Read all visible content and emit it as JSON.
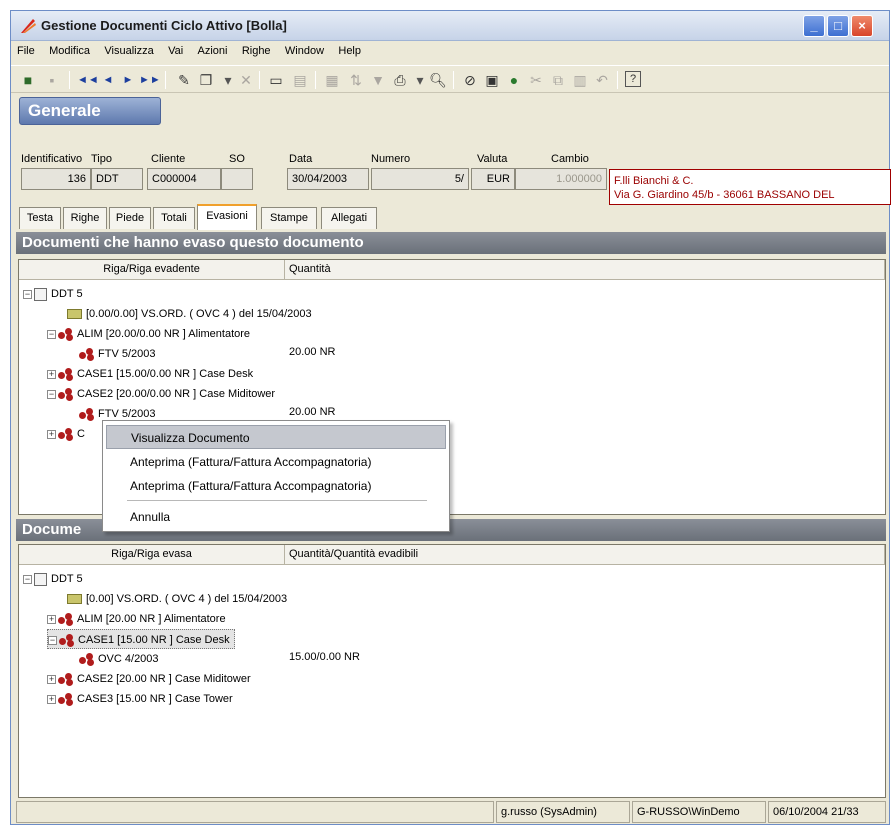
{
  "window": {
    "title": "Gestione Documenti Ciclo Attivo [Bolla]",
    "controls": {
      "minimize": "_",
      "maximize": "□",
      "close": "×"
    }
  },
  "menu": [
    "File",
    "Modifica",
    "Visualizza",
    "Vai",
    "Azioni",
    "Righe",
    "Window",
    "Help"
  ],
  "toolbar_icons": [
    "save-icon",
    "first-record-icon",
    "prev-record-icon",
    "next-record-icon",
    "last-record-icon",
    "edit-icon",
    "new-doc-icon",
    "delete-icon",
    "window-icon",
    "print-icon",
    "preview-icon",
    "help-icon"
  ],
  "general_button": "Generale",
  "header": {
    "labels": {
      "identificativo": "Identificativo",
      "tipo": "Tipo",
      "cliente": "Cliente",
      "so": "SO",
      "data": "Data",
      "numero": "Numero",
      "valuta": "Valuta",
      "cambio": "Cambio"
    },
    "values": {
      "identificativo": "136",
      "tipo": "DDT",
      "cliente": "C000004",
      "so": "",
      "data": "30/04/2003",
      "numero": "5/",
      "valuta": "EUR",
      "cambio": "1.000000"
    },
    "address_line1": "F.lli Bianchi & C.",
    "address_line2": "Via G. Giardino 45/b - 36061 BASSANO DEL"
  },
  "tabs": [
    "Testa",
    "Righe",
    "Piede",
    "Totali",
    "Evasioni",
    "Stampe",
    "Allegati"
  ],
  "section1": {
    "title": "Documenti che hanno evaso questo documento",
    "col1": "Riga/Riga evadente",
    "col2": "Quantità",
    "rows": [
      {
        "text": "DDT 5",
        "qty": ""
      },
      {
        "text": "[0.00/0.00] VS.ORD. ( OVC    4  ) del 15/04/2003",
        "qty": ""
      },
      {
        "text": "ALIM [20.00/0.00 NR ] Alimentatore",
        "qty": ""
      },
      {
        "text": "FTV 5/2003",
        "qty": "20.00 NR"
      },
      {
        "text": "CASE1 [15.00/0.00 NR ] Case Desk",
        "qty": ""
      },
      {
        "text": "CASE2 [20.00/0.00 NR ] Case Miditower",
        "qty": ""
      },
      {
        "text": "FTV 5/2003",
        "qty": "20.00 NR"
      },
      {
        "text": "C",
        "qty": ""
      }
    ]
  },
  "context_menu": {
    "items": [
      "Visualizza Documento",
      "Anteprima (Fattura/Fattura Accompagnatoria)",
      "Anteprima (Fattura/Fattura Accompagnatoria)",
      "Annulla"
    ]
  },
  "section2": {
    "title": "Docume",
    "col1": "Riga/Riga evasa",
    "col2": "Quantità/Quantità evadibili",
    "rows": [
      {
        "text": "DDT    5",
        "qty": ""
      },
      {
        "text": "[0.00] VS.ORD. ( OVC    4  ) del 15/04/2003",
        "qty": ""
      },
      {
        "text": "ALIM [20.00 NR ] Alimentatore",
        "qty": ""
      },
      {
        "text": "CASE1 [15.00 NR ] Case Desk",
        "qty": ""
      },
      {
        "text": "OVC 4/2003",
        "qty": "15.00/0.00 NR"
      },
      {
        "text": "CASE2 [20.00 NR ] Case Miditower",
        "qty": ""
      },
      {
        "text": "CASE3 [15.00 NR ] Case Tower",
        "qty": ""
      }
    ]
  },
  "statusbar": {
    "user": "g.russo (SysAdmin)",
    "host": "G-RUSSO\\WinDemo",
    "datetime": "06/10/2004 21/33"
  }
}
